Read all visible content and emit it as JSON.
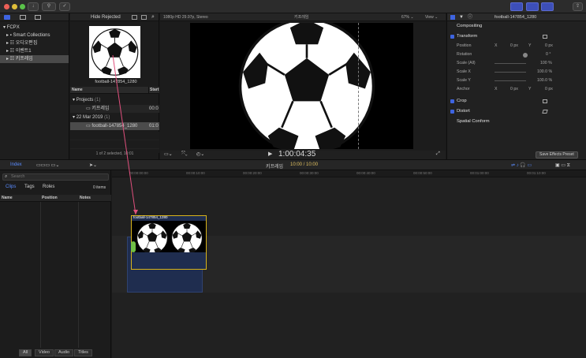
{
  "toolbar": {
    "hide_rejected": "Hide Rejected",
    "colors": {
      "accent": "#3e64e0",
      "selection": "#d9b41a",
      "link": "#e0507d"
    }
  },
  "library": {
    "items": [
      {
        "label": "FCPX"
      },
      {
        "label": "Smart Collections"
      },
      {
        "label": "오디오편집"
      },
      {
        "label": "이벤트1"
      },
      {
        "label": "키프레임"
      }
    ]
  },
  "browser": {
    "thumb_label": "football-147854_1280",
    "col_name": "Name",
    "col_start": "Start",
    "projects_label": "Projects",
    "projects_count": "(1)",
    "project_item": "키프레임",
    "project_start": "00:0",
    "date_label": "22 Mar 2019",
    "date_count": "(1)",
    "clip_item": "football-147854_1280",
    "clip_start": "01:0",
    "status": "1 of 2 selected, 10:01"
  },
  "viewer": {
    "format": "1080p HD 29.97p, Stereo",
    "title": "키프레임",
    "zoom": "67%",
    "view": "View",
    "timecode": "1:00:04:35"
  },
  "inspector": {
    "clip_name": "football-147854_1280",
    "compositing": "Compositing",
    "transform": "Transform",
    "position_label": "Position",
    "pos_x_label": "X",
    "pos_x": "0",
    "pos_y_label": "Y",
    "pos_y": "0",
    "px": "px",
    "rotation_label": "Rotation",
    "rotation": "0",
    "deg": "°",
    "scale_all_label": "Scale (All)",
    "scale_all": "100",
    "scale_x_label": "Scale X",
    "scale_x": "100.0",
    "scale_y_label": "Scale Y",
    "scale_y": "100.0",
    "pct": "%",
    "anchor_label": "Anchor",
    "anchor_x": "0",
    "anchor_y": "0",
    "crop": "Crop",
    "distort": "Distort",
    "spatial_conform": "Spatial Conform",
    "save_preset": "Save Effects Preset"
  },
  "midbar": {
    "index": "Index",
    "project_name": "키프레임",
    "duration": "10:00 / 10:00"
  },
  "timeline_index": {
    "search_placeholder": "Search",
    "tabs": [
      "Clips",
      "Tags",
      "Roles"
    ],
    "items_count": "0 items",
    "cols": [
      "Name",
      "Position",
      "Notes"
    ],
    "filters": [
      "All",
      "Video",
      "Audio",
      "Titles"
    ]
  },
  "timeline": {
    "ruler": [
      "00:00:00:00",
      "00:00:10:00",
      "00:00:20:00",
      "00:00:30:00",
      "00:00:40:00",
      "00:00:50:00",
      "00:01:00:00",
      "00:01:10:00"
    ],
    "clip_label": "football-147854_1280"
  }
}
